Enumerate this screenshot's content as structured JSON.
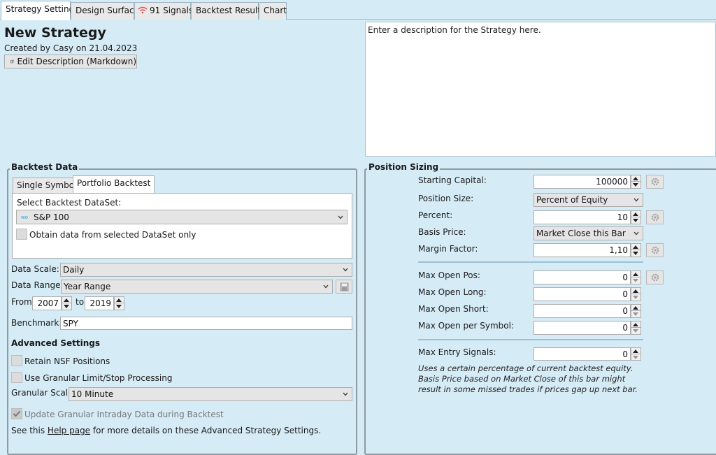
{
  "tabs": [
    {
      "label": "Strategy Settings"
    },
    {
      "label": "Design Surface"
    },
    {
      "label": "91 Signals"
    },
    {
      "label": "Backtest Results"
    },
    {
      "label": "Chart"
    }
  ],
  "header": {
    "title": "New Strategy",
    "created_by": "Created by Casy on 21.04.2023",
    "edit_description_label": "Edit Description (Markdown)"
  },
  "description": {
    "text": "Enter a description for the Strategy here."
  },
  "backtest": {
    "group_label": "Backtest Data",
    "subtabs": [
      "Single Symbol",
      "Portfolio Backtest"
    ],
    "select_dataset_label": "Select Backtest DataSet:",
    "dataset_badge": "wo",
    "dataset_value": "S&P 100",
    "obtain_only_label": "Obtain data from selected DataSet only",
    "data_scale_label": "Data Scale:",
    "data_scale_value": "Daily",
    "data_range_label": "Data Range:",
    "data_range_value": "Year Range",
    "from_label": "From",
    "from_value": "2007",
    "to_label": "to",
    "to_value": "2019",
    "benchmark_label": "Benchmark:",
    "benchmark_value": "SPY",
    "advanced_title": "Advanced Settings",
    "retain_nsf_label": "Retain NSF Positions",
    "granular_limit_label": "Use Granular Limit/Stop Processing",
    "granular_scale_label": "Granular Scale",
    "granular_scale_value": "10 Minute",
    "update_granular_label": "Update Granular Intraday Data during Backtest",
    "help_prefix": "See this ",
    "help_link": "Help page",
    "help_suffix": " for more details on these Advanced Strategy Settings."
  },
  "position_sizing": {
    "group_label": "Position Sizing",
    "starting_capital_label": "Starting Capital:",
    "starting_capital_value": "100000",
    "position_size_label": "Position Size:",
    "position_size_value": "Percent of Equity",
    "percent_label": "Percent:",
    "percent_value": "10",
    "basis_price_label": "Basis Price:",
    "basis_price_value": "Market Close this Bar",
    "margin_factor_label": "Margin Factor:",
    "margin_factor_value": "1,10",
    "max_open_pos_label": "Max Open Pos:",
    "max_open_pos_value": "0",
    "max_open_long_label": "Max Open Long:",
    "max_open_long_value": "0",
    "max_open_short_label": "Max Open Short:",
    "max_open_short_value": "0",
    "max_open_per_symbol_label": "Max Open per Symbol:",
    "max_open_per_symbol_value": "0",
    "max_entry_signals_label": "Max Entry Signals:",
    "max_entry_signals_value": "0",
    "note": "Uses a certain percentage of current backtest equity. Basis Price based on Market Close of this bar might result in some missed trades if prices gap up next bar."
  },
  "colors": {
    "background": "#d5ebf5",
    "signal_icon": "#e05050",
    "dataset_badge": "#2a9fd6"
  },
  "icons": {
    "edit": "edit-icon",
    "signals": "wifi-signal-icon",
    "gear": "gear-icon",
    "save": "save-icon"
  }
}
